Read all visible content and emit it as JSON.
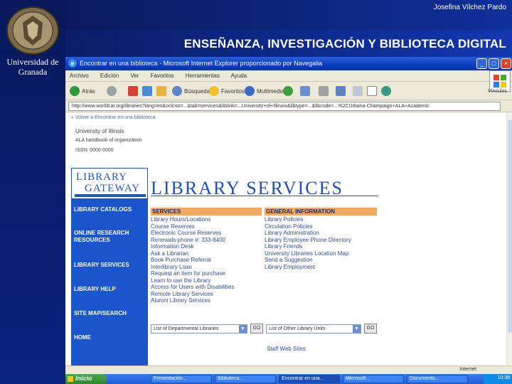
{
  "slide": {
    "author": "Josefina Vílchez Pardo",
    "title": "ENSEÑANZA, INVESTIGACIÓN Y BIBLIOTECA DIGITAL",
    "university": "Universidad de Granada"
  },
  "browser": {
    "window_title": "Encontrar en una biblioteca - Microsoft Internet Explorer proporcionado por Navegalia",
    "menu": [
      "Archivo",
      "Edición",
      "Ver",
      "Favoritos",
      "Herramientas",
      "Ayuda"
    ],
    "toolbar": {
      "back": "Atrás",
      "search": "Búsqueda",
      "favorites": "Favoritos",
      "multimedia": "Multimedia",
      "links": "Vínculos"
    },
    "address": "http://www.worldcat.org/libraries?lang=es&oclcno=...&tab=services&liblink=...University+of+Illinois&libtype=...&libcode=...%2CUrbana-Champaign+ALA+Academic",
    "status_zone": "Internet"
  },
  "page": {
    "breadcrumb": "« Volver a Encontrar en una biblioteca",
    "institution": "University of Illinois",
    "handbook": "ALA handbook of organization",
    "issn": "ISSN: 0000-0000",
    "gateway": {
      "line1": "LIBRARY",
      "line2": "GATEWAY",
      "nav": [
        "LIBRARY CATALOGS",
        "ONLINE RESEARCH RESOURCES",
        "LIBRARY SERVICES",
        "LIBRARY HELP",
        "SITE MAP/SEARCH",
        "HOME"
      ]
    },
    "section_title": "LIBRARY SERVICES",
    "services": {
      "header": "SERVICES",
      "items": [
        "Library Hours/Locations",
        "Course Reserves",
        "Electronic Course Reserves",
        "Renewals-phone #: 333-8400",
        "Information Desk",
        "Ask a Librarian",
        "Book Purchase Referral",
        "Interlibrary Loan",
        "Request an item for purchase",
        "Learn to use the Library",
        "Access for Users with Disabilities",
        "Remote Library Services",
        "Alumni Library Services"
      ]
    },
    "general": {
      "header": "GENERAL INFORMATION",
      "items": [
        "Library Policies",
        "Circulation Policies",
        "Library Administration",
        "Library Employee Phone Directory",
        "Library Friends",
        "University Libraries Location Map",
        "Send a Suggestion",
        "Library Employment"
      ]
    },
    "dept_select": "List of Departmental Libraries",
    "other_select": "List of Other Library Units",
    "go_label": "GO",
    "staff_link": "Staff Web Sites"
  },
  "taskbar": {
    "start": "Inicio",
    "items": [
      "Presentación...",
      "Biblioteca...",
      "Encontrar en una...",
      "Microsoft...",
      "Documento..."
    ],
    "time": "10:38"
  }
}
